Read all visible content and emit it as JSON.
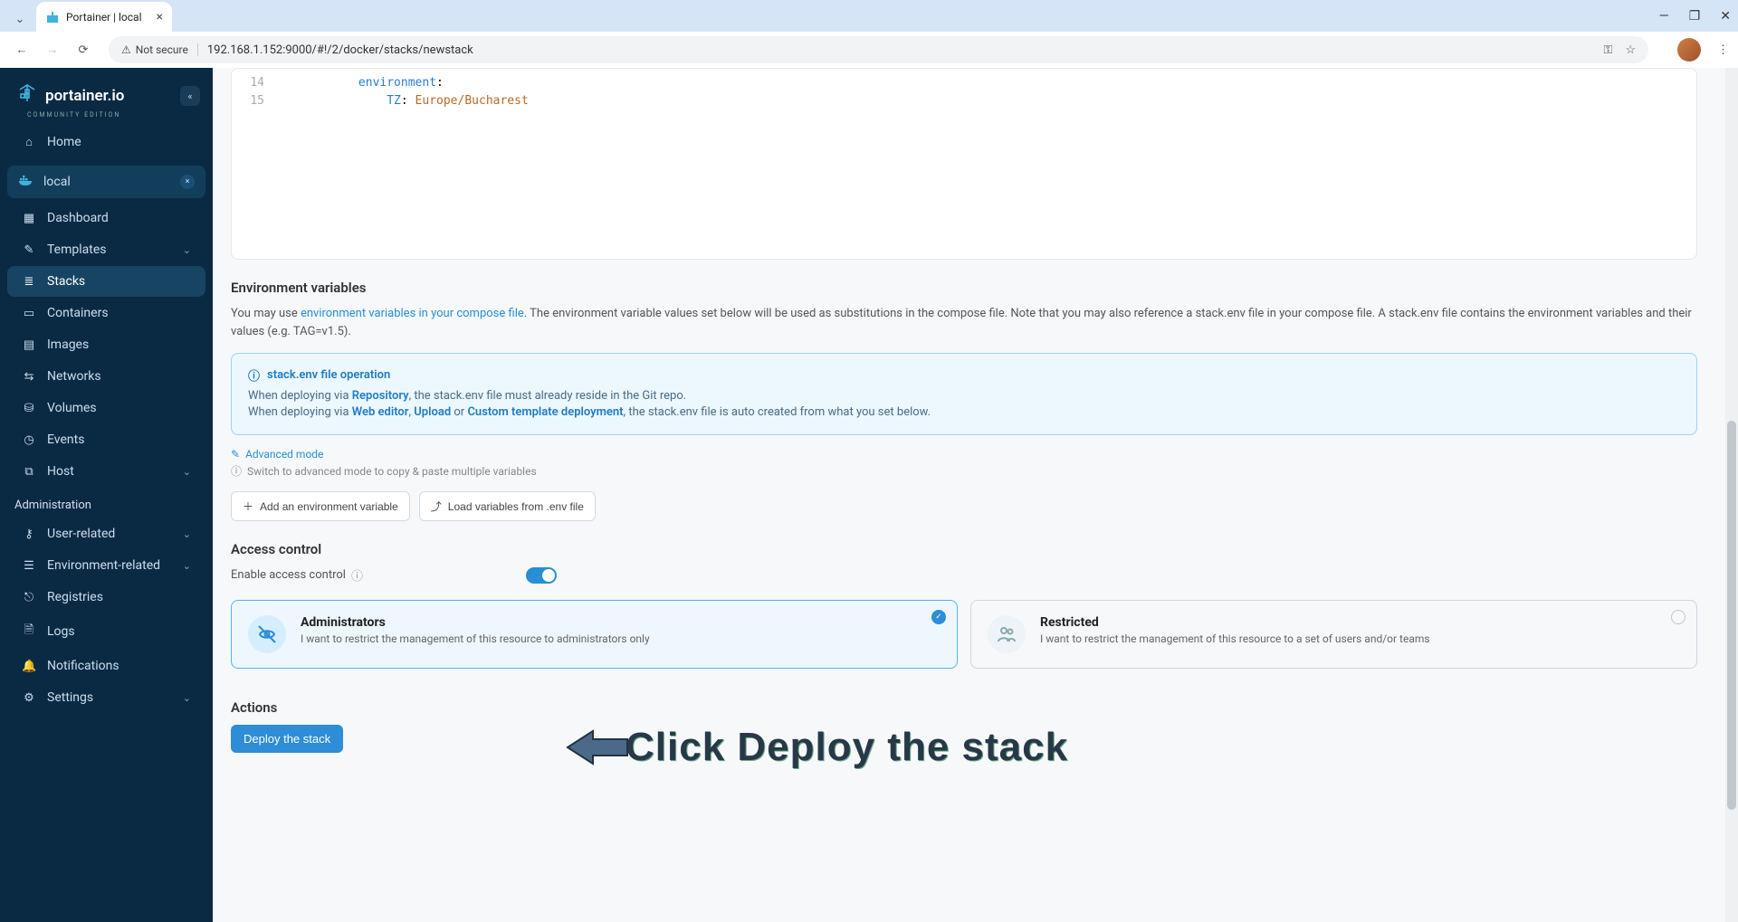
{
  "browser": {
    "tab_title": "Portainer | local",
    "security_label": "Not secure",
    "url": "192.168.1.152:9000/#!/2/docker/stacks/newstack"
  },
  "sidebar": {
    "logo_text": "portainer.io",
    "logo_sub": "COMMUNITY EDITION",
    "home": "Home",
    "env_name": "local",
    "items": [
      {
        "icon": "▦",
        "label": "Dashboard"
      },
      {
        "icon": "✎",
        "label": "Templates",
        "expandable": true
      },
      {
        "icon": "≣",
        "label": "Stacks",
        "active": true
      },
      {
        "icon": "▭",
        "label": "Containers"
      },
      {
        "icon": "▤",
        "label": "Images"
      },
      {
        "icon": "⇆",
        "label": "Networks"
      },
      {
        "icon": "⛁",
        "label": "Volumes"
      },
      {
        "icon": "◷",
        "label": "Events"
      },
      {
        "icon": "⧉",
        "label": "Host",
        "expandable": true
      }
    ],
    "admin_label": "Administration",
    "admin_items": [
      {
        "icon": "⚷",
        "label": "User-related",
        "expandable": true
      },
      {
        "icon": "☰",
        "label": "Environment-related",
        "expandable": true
      },
      {
        "icon": "⎋",
        "label": "Registries"
      },
      {
        "icon": "🗎",
        "label": "Logs"
      },
      {
        "icon": "🔔",
        "label": "Notifications"
      },
      {
        "icon": "⚙",
        "label": "Settings",
        "expandable": true
      }
    ]
  },
  "editor": {
    "lines": [
      {
        "num": "14",
        "indent": 3,
        "key": "environment",
        "suffix": ":"
      },
      {
        "num": "15",
        "indent": 4,
        "key": "TZ",
        "suffix": ": ",
        "val": "Europe/Bucharest"
      }
    ]
  },
  "env_section": {
    "title": "Environment variables",
    "desc_pre": "You may use ",
    "desc_link": "environment variables in your compose file",
    "desc_post": ". The environment variable values set below will be used as substitutions in the compose file. Note that you may also reference a stack.env file in your compose file. A stack.env file contains the environment variables and their values (e.g. TAG=v1.5).",
    "info_title": "stack.env file operation",
    "info_line1_pre": "When deploying via ",
    "info_line1_b1": "Repository",
    "info_line1_post": ", the stack.env file must already reside in the Git repo.",
    "info_line2_pre": "When deploying via ",
    "info_line2_b1": "Web editor",
    "info_line2_sep1": ", ",
    "info_line2_b2": "Upload",
    "info_line2_sep2": " or ",
    "info_line2_b3": "Custom template deployment",
    "info_line2_post": ", the stack.env file is auto created from what you set below.",
    "adv_mode": "Advanced mode",
    "adv_hint": "Switch to advanced mode to copy & paste multiple variables",
    "add_btn": "Add an environment variable",
    "load_btn": "Load variables from .env file"
  },
  "access": {
    "title": "Access control",
    "toggle_label": "Enable access control",
    "admin_title": "Administrators",
    "admin_desc": "I want to restrict the management of this resource to administrators only",
    "restrict_title": "Restricted",
    "restrict_desc": "I want to restrict the management of this resource to a set of users and/or teams"
  },
  "actions": {
    "title": "Actions",
    "deploy": "Deploy the stack"
  },
  "annotation": "Click Deploy the stack"
}
